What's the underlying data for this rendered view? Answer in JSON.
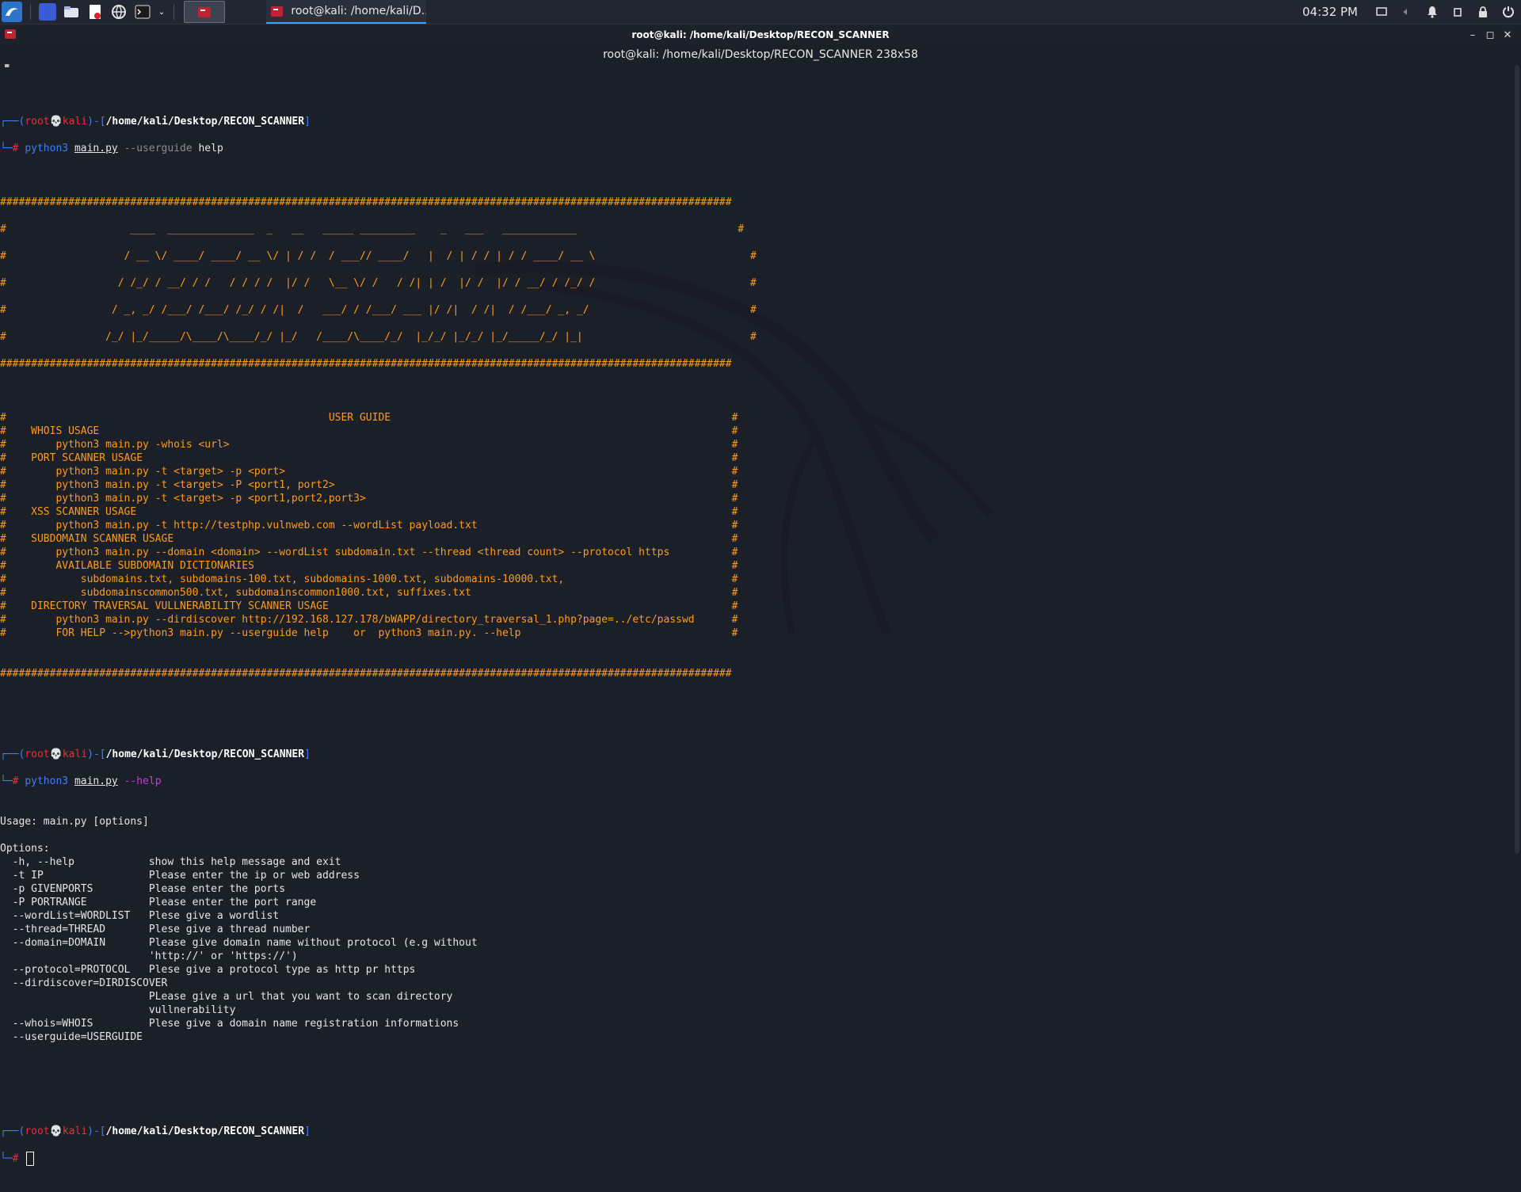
{
  "taskbar": {
    "active_task_title": "root@kali: /home/kali/D...",
    "clock": "04:32 PM",
    "launchers": [
      "kali-menu-icon",
      "workspace-icon",
      "file-manager-icon",
      "text-editor-icon",
      "browser-icon",
      "terminal-icon"
    ]
  },
  "window": {
    "title": "root@kali: /home/kali/Desktop/RECON_SCANNER",
    "tab_title": "root@kali: /home/kali/Desktop/RECON_SCANNER 238x58"
  },
  "prompt": {
    "user": "root",
    "host": "kali",
    "path": "/home/kali/Desktop/RECON_SCANNER"
  },
  "commands": {
    "cmd1": {
      "prog": "python3",
      "file": "main.py",
      "opt": "--userguide",
      "arg": "help"
    },
    "cmd2": {
      "prog": "python3",
      "file": "main.py",
      "opt": "--help"
    }
  },
  "banner": {
    "border": "######################################################################################################################",
    "art": [
      "#                    ____  ______________  _   __   _____ _________    _   ___   ____________                          #",
      "#                   / __ \\/ ____/ ____/ __ \\/ | / /  / ___// ____/   |  / | / / | / / ____/ __ \\                         #",
      "#                  / /_/ / __/ / /   / / / /  |/ /   \\__ \\/ /   / /| | /  |/ /  |/ / __/ / /_/ /                         #",
      "#                 / _, _/ /___/ /___/ /_/ / /|  /   ___/ / /___/ ___ |/ /|  / /|  / /___/ _, _/                          #",
      "#                /_/ |_/_____/\\____/\\____/_/ |_/   /____/\\____/_/  |_/_/ |_/_/ |_/_____/_/ |_|                           #"
    ]
  },
  "guide": [
    {
      "t": "USER GUIDE",
      "i": 52
    },
    {
      "t": "WHOIS USAGE",
      "i": 4
    },
    {
      "t": "python3 main.py -whois <url>",
      "i": 8
    },
    {
      "t": "PORT SCANNER USAGE",
      "i": 4
    },
    {
      "t": "python3 main.py -t <target> -p <port>",
      "i": 8
    },
    {
      "t": "python3 main.py -t <target> -P <port1, port2>",
      "i": 8
    },
    {
      "t": "python3 main.py -t <target> -p <port1,port2,port3>",
      "i": 8
    },
    {
      "t": "XSS SCANNER USAGE",
      "i": 4
    },
    {
      "t": "python3 main.py -t http://testphp.vulnweb.com --wordList payload.txt",
      "i": 8
    },
    {
      "t": "SUBDOMAIN SCANNER USAGE",
      "i": 4
    },
    {
      "t": "python3 main.py --domain <domain> --wordList subdomain.txt --thread <thread count> --protocol https",
      "i": 8
    },
    {
      "t": "AVAILABLE SUBDOMAIN DICTIONARIES",
      "i": 8
    },
    {
      "t": "subdomains.txt, subdomains-100.txt, subdomains-1000.txt, subdomains-10000.txt,",
      "i": 12
    },
    {
      "t": "subdomainscommon500.txt, subdomainscommon1000.txt, suffixes.txt",
      "i": 12
    },
    {
      "t": "DIRECTORY TRAVERSAL VULLNERABILITY SCANNER USAGE",
      "i": 4
    },
    {
      "t": "python3 main.py --dirdiscover http://192.168.127.178/bWAPP/directory_traversal_1.php?page=../etc/passwd",
      "i": 8
    },
    {
      "t": "FOR HELP -->python3 main.py --userguide help    or  python3 main.py. --help",
      "i": 8
    }
  ],
  "help_output": [
    "Usage: main.py [options]",
    "",
    "Options:",
    "  -h, --help            show this help message and exit",
    "  -t IP                 Please enter the ip or web address",
    "  -p GIVENPORTS         Please enter the ports",
    "  -P PORTRANGE          Please enter the port range",
    "  --wordList=WORDLIST   Plese give a wordlist",
    "  --thread=THREAD       Plese give a thread number",
    "  --domain=DOMAIN       Please give domain name without protocol (e.g without",
    "                        'http://' or 'https://')",
    "  --protocol=PROTOCOL   Plese give a protocol type as http pr https",
    "  --dirdiscover=DIRDISCOVER",
    "                        PLease give a url that you want to scan directory",
    "                        vullnerability",
    "  --whois=WHOIS         Plese give a domain name registration informations",
    "  --userguide=USERGUIDE"
  ]
}
